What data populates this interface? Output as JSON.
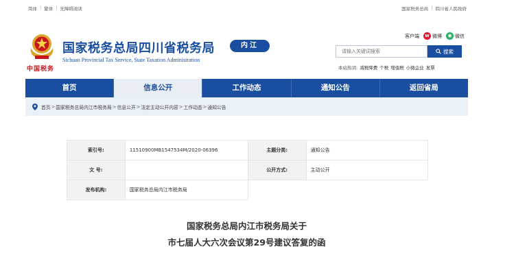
{
  "topbar": {
    "left": [
      "简体",
      "繁体",
      "无障碍阅读"
    ],
    "right": [
      "国家税务总局",
      "四川省人民政府"
    ]
  },
  "header": {
    "emblem_caption": "中国税务",
    "title": "国家税务总局四川省税务局",
    "subtitle": "Sichuan Provincial Tax Service, State Taxation Administration",
    "region": "内江",
    "social": {
      "client": "客户端",
      "weibo": "微博",
      "weixin": "微信"
    },
    "search": {
      "placeholder": "请输入关键词搜索",
      "button": "搜索"
    },
    "hotwords": {
      "label": "本站热词:",
      "items": [
        "减税降费",
        "个税",
        "增值税",
        "小微企业",
        "发票"
      ]
    }
  },
  "nav": {
    "items": [
      "首页",
      "信息公开",
      "工作动态",
      "通知公告",
      "返回省局"
    ],
    "active_index": 1
  },
  "breadcrumb": [
    "首页",
    "国家税务总局内江市税务局",
    "信息公开",
    "法定主动公开内容",
    "工作动态",
    "通知公告"
  ],
  "info": {
    "index_label": "索引号:",
    "index_value": "11510900MB1547534M/2020-06396",
    "topic_label": "主题分类:",
    "topic_value": "通知公告",
    "docno_label": "文 号:",
    "docno_value": "",
    "publish_label": "公开方式:",
    "publish_value": "主动公开",
    "org_label": "发布机构:",
    "org_value": "国家税务总局内江市税务局"
  },
  "document": {
    "title_line1": "国家税务总局内江市税务局关于",
    "title_line2": "市七届人大六次会议第29号建议答复的函"
  },
  "colors": {
    "brand_blue": "#1a4ea1",
    "emblem_red": "#c8161d",
    "nav_active_bg": "#e9eef5",
    "breadcrumb_bg": "#eaf0f7"
  }
}
